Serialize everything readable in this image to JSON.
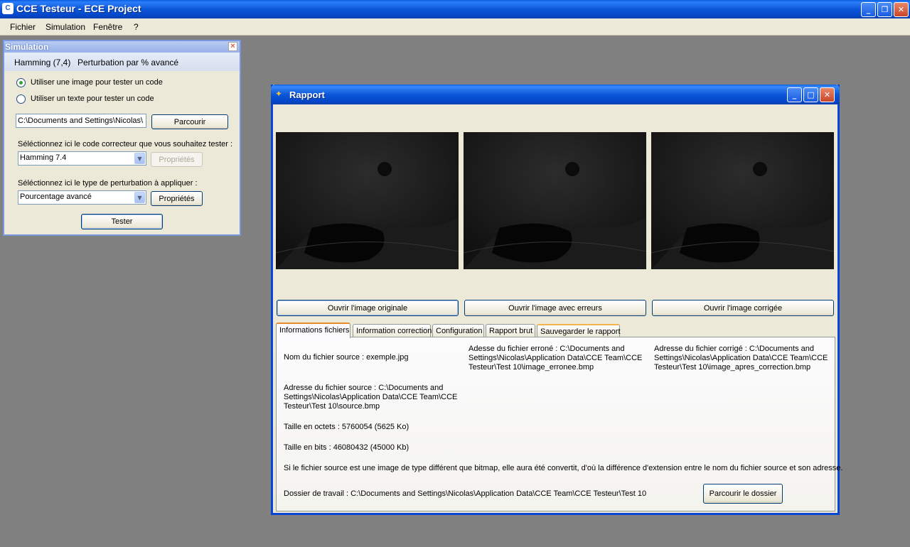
{
  "app": {
    "title": "CCE Testeur - ECE Project",
    "icon": "C",
    "controls": {
      "minimize": "_",
      "restore": "❐",
      "close": "✕"
    }
  },
  "menu": [
    "Fichier",
    "Simulation",
    "Fenêtre",
    "?"
  ],
  "simulation": {
    "title": "Simulation",
    "close": "✕",
    "summary_code": "Hamming (7,4)",
    "summary_perturbation": "Perturbation par % avancé",
    "radio_image": "Utiliser une image pour tester un code",
    "radio_text": "Utiliser un texte pour tester un code",
    "selected_radio": "image",
    "path_value": "C:\\Documents and Settings\\Nicolas\\",
    "browse_label": "Parcourir",
    "code_label": "Séléctionnez ici le code correcteur que vous souhaitez tester :",
    "code_value": "Hamming 7.4",
    "code_props_label": "Propriétés",
    "perturb_label": "Séléctionnez ici le type de perturbation à appliquer :",
    "perturb_value": "Pourcentage avancé",
    "perturb_props_label": "Propriétés",
    "test_label": "Tester"
  },
  "rapport": {
    "title": "Rapport",
    "icon": "✦",
    "controls": {
      "minimize": "_",
      "maximize": "□",
      "close": "✕"
    },
    "buttons": {
      "open_original": "Ouvrir l'image originale",
      "open_errors": "Ouvrir l'image avec erreurs",
      "open_corrected": "Ouvrir l'image corrigée"
    },
    "tabs": [
      "Informations fichiers",
      "Information correction",
      "Configuration",
      "Rapport brut",
      "Sauvegarder le rapport"
    ],
    "active_tab": 0,
    "info": {
      "source_name": "Nom du fichier source : exemple.jpg",
      "error_path": "Adesse du fichier erroné : C:\\Documents and Settings\\Nicolas\\Application Data\\CCE Team\\CCE Testeur\\Test 10\\image_erronee.bmp",
      "corrected_path": "Adresse du fichier corrigé : C:\\Documents and Settings\\Nicolas\\Application Data\\CCE Team\\CCE Testeur\\Test 10\\image_apres_correction.bmp",
      "source_path": "Adresse du fichier source : C:\\Documents and Settings\\Nicolas\\Application Data\\CCE Team\\CCE Testeur\\Test 10\\source.bmp",
      "size_bytes": "Taille en octets : 5760054 (5625 Ko)",
      "size_bits": "Taille en bits : 46080432 (45000 Kb)",
      "note": "Si le fichier source est une image de type différent que bitmap, elle aura été convertit, d'où la différence d'extension entre le nom du fichier source et son adresse.",
      "work_dir": "Dossier de travail : C:\\Documents and Settings\\Nicolas\\Application Data\\CCE Team\\CCE Testeur\\Test 10",
      "browse_folder_label": "Parcourir le dossier"
    }
  }
}
